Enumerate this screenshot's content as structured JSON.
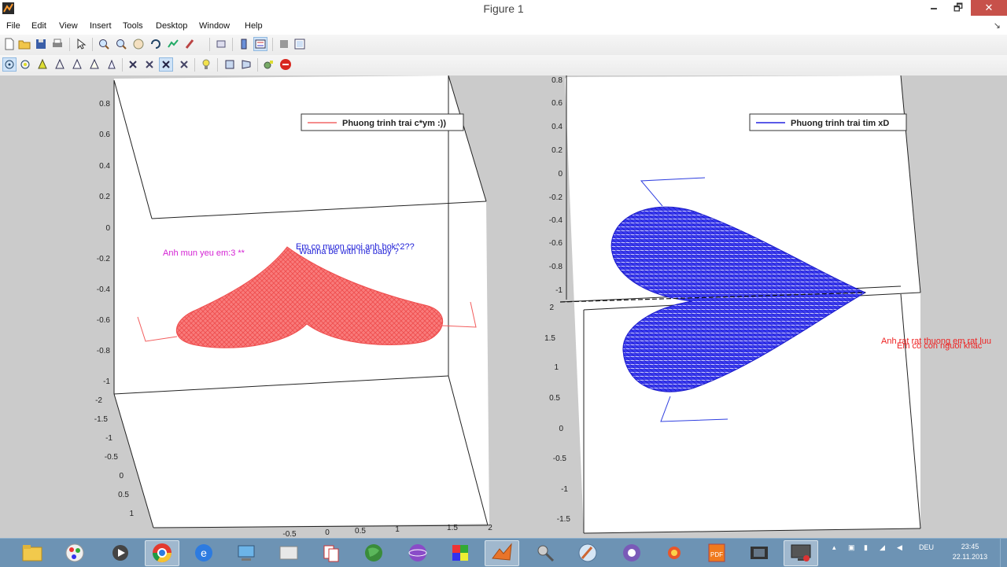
{
  "window": {
    "title": "Figure 1",
    "minimize": "🗕",
    "restore": "🗗",
    "close": "✕"
  },
  "menu": [
    "File",
    "Edit",
    "View",
    "Insert",
    "Tools",
    "Desktop",
    "Window",
    "Help"
  ],
  "menu_arrow": "↘",
  "toolbar1": [
    "new-figure-icon",
    "open-icon",
    "save-icon",
    "print-icon",
    "pointer-icon",
    "zoom-in-icon",
    "zoom-out-icon",
    "pan-icon",
    "rotate-3d-icon",
    "data-cursor-icon",
    "brush-icon",
    "link-icon",
    "colorbar-icon",
    "legend-icon",
    "hide-plot-tools-icon",
    "show-plot-tools-icon"
  ],
  "toolbar2": [
    "orbit-camera-icon",
    "orbit-scene-light-icon",
    "pan-tilt-camera-icon",
    "move-camera-horizontally-icon",
    "move-camera-forward-icon",
    "move-camera-vertically-icon",
    "roll-camera-icon",
    "dolly-camera-icon",
    "walk-camera-icon",
    "stop-camera-icon",
    "toggle-scene-light-icon",
    "orthographic-icon",
    "perspective-icon",
    "reset-camera-icon",
    "stop-icon"
  ],
  "plot_left": {
    "legend": "Phuong trinh trai c*ym :))",
    "annotation_magenta": "Anh mun yeu em:3 **",
    "annotation_blue_1": "Em co muon cuoi anh hok^2??",
    "annotation_blue_2": "Wanna be with me baby ?",
    "yticks": [
      "0.8",
      "0.6",
      "0.4",
      "0.2",
      "0",
      "-0.2",
      "-0.4",
      "-0.6",
      "-0.8",
      "-1"
    ],
    "zticks": [
      "-2",
      "-1.5",
      "-1",
      "-0.5",
      "0",
      "0.5",
      "1"
    ],
    "xticks": [
      "-0.5",
      "0",
      "0.5",
      "1",
      "1.5",
      "2"
    ],
    "color": "#f25c5c"
  },
  "plot_right": {
    "legend": "Phuong trinh trai tim xD",
    "annotation_red_1": "Anh rat rat thuong em rat luu",
    "annotation_red_2": "Em co con nguoi khac",
    "yticks_top": [
      "0.8",
      "0.6",
      "0.4",
      "0.2",
      "0",
      "-0.2",
      "-0.4",
      "-0.6",
      "-0.8",
      "-1"
    ],
    "yticks_bottom": [
      "2",
      "1.5",
      "1",
      "0.5",
      "0",
      "-0.5",
      "-1",
      "-1.5"
    ],
    "color": "#2222dd"
  },
  "taskbar": {
    "apps": [
      "file-explorer-icon",
      "paint-icon",
      "media-player-icon",
      "chrome-icon",
      "ie-icon",
      "network-icon",
      "folder-icon",
      "solitaire-icon",
      "earth-icon",
      "orb-icon",
      "mosaic-icon",
      "matlab-icon",
      "tool-icon",
      "paint-brush-icon",
      "camera-icon",
      "sun-icon",
      "pdf-icon",
      "movie-icon",
      "monitor-icon"
    ],
    "tray_lang": "DEU",
    "time": "23:45",
    "date": "22.11.2013"
  },
  "colors": {
    "figure_bg": "#cbcbcb",
    "taskbar_bg": "#6d93b4",
    "close_button": "#c7514a"
  }
}
